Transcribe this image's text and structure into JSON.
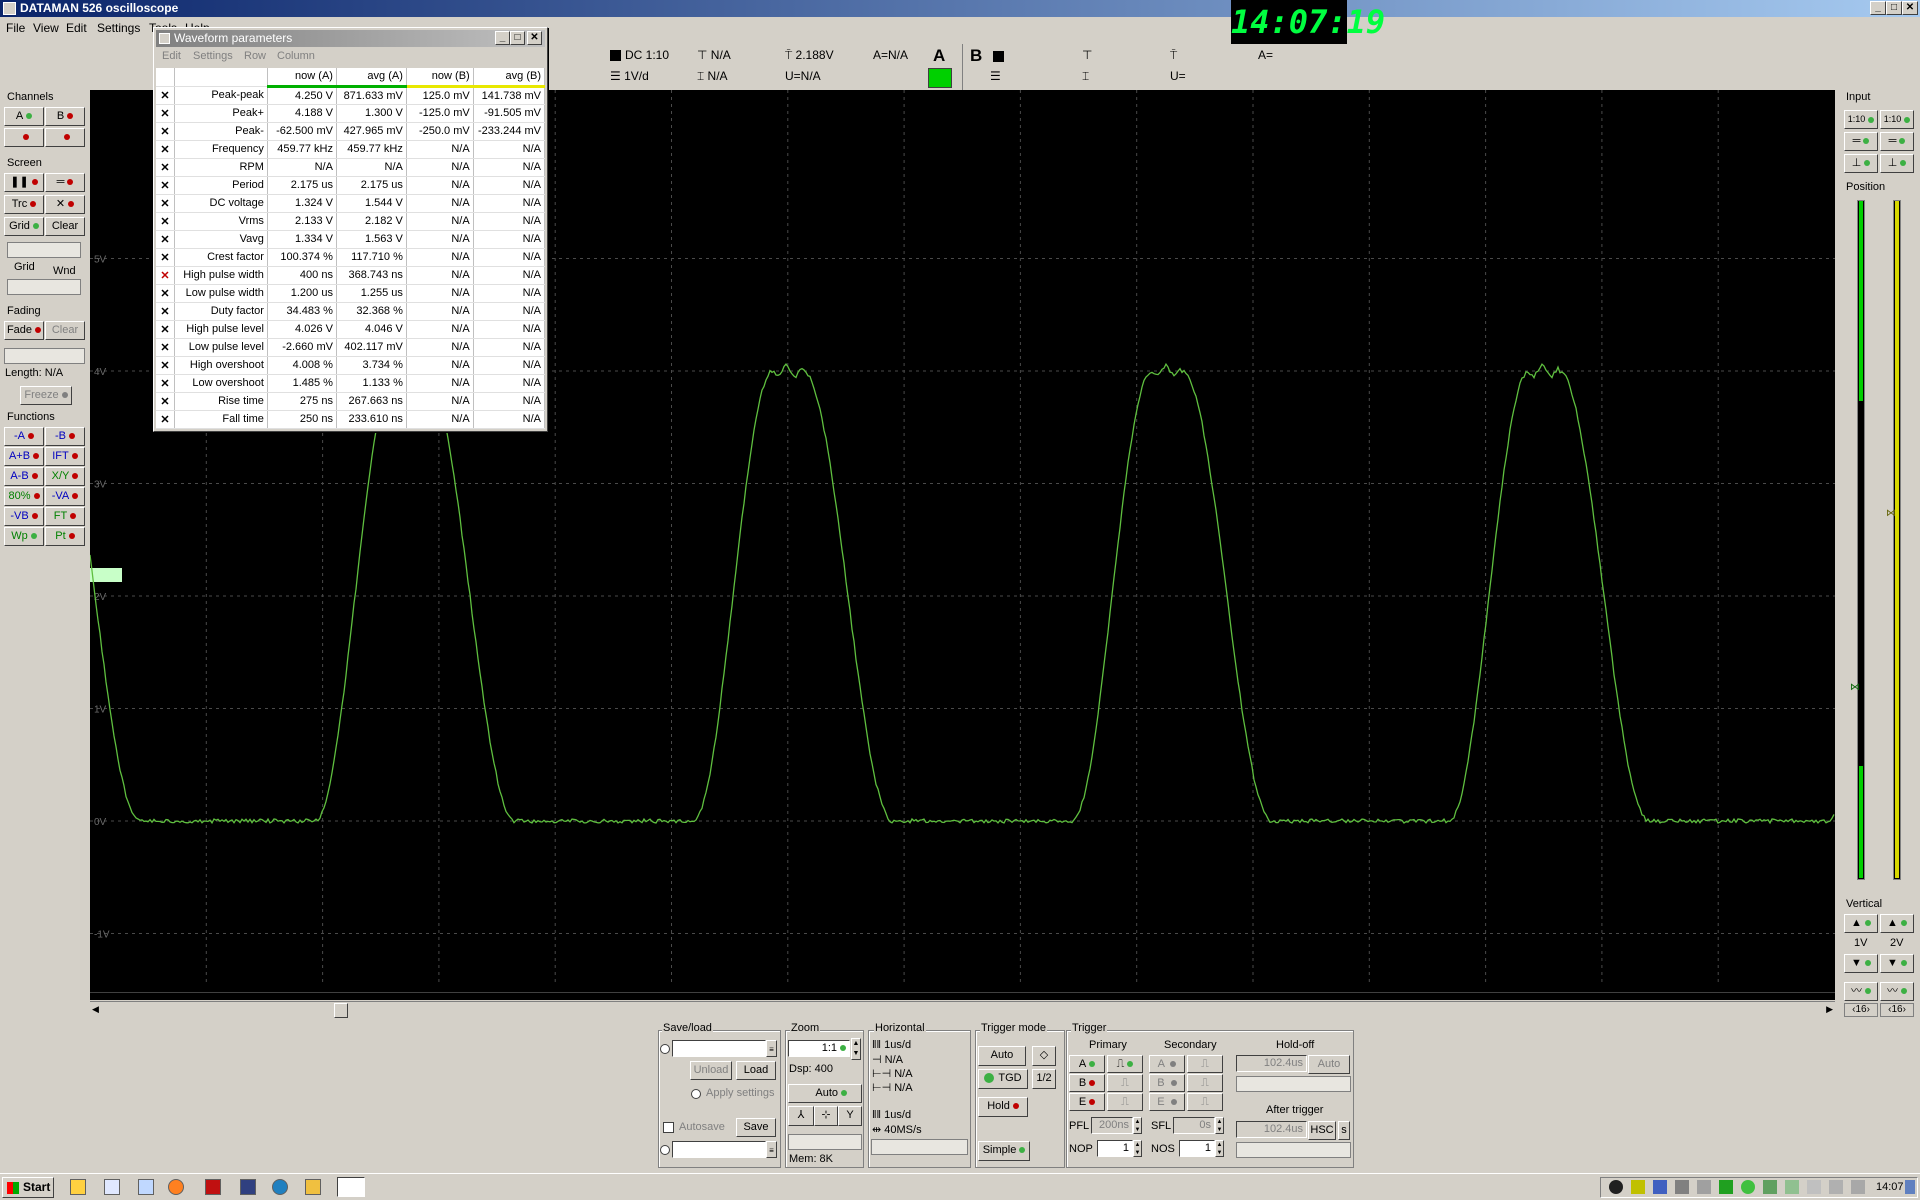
{
  "window": {
    "title": "DATAMAN 526 oscilloscope"
  },
  "menu": [
    "File",
    "View",
    "Edit",
    "Settings",
    "Tools",
    "Help"
  ],
  "clock": "14:07:19",
  "toolbar": {
    "a_coupling": "DC 1:10",
    "a_scale": "1V/d",
    "a_trig_level": "N/A",
    "a_time_cursor": "N/A",
    "a_volt": "2.188V",
    "a_u": "U=N/A",
    "a_eq": "A=N/A",
    "channel_a": "A",
    "channel_b": "B",
    "b_u": "U=",
    "b_eq": "A="
  },
  "left": {
    "channels_label": "Channels",
    "ch_a": "A",
    "ch_b": "B",
    "screen_label": "Screen",
    "trc": "Trc",
    "grid": "Grid",
    "clear": "Clear",
    "grid2": "Grid",
    "wnd": "Wnd",
    "fading_label": "Fading",
    "fade": "Fade",
    "fade_clear": "Clear",
    "length": "Length: N/A",
    "freeze": "Freeze",
    "functions_label": "Functions",
    "functions": [
      [
        "-A",
        "-B"
      ],
      [
        "A+B",
        "IFT"
      ],
      [
        "A-B",
        "X/Y"
      ],
      [
        "80%",
        "-VA"
      ],
      [
        "-VB",
        "FT"
      ],
      [
        "Wp",
        "Pt"
      ]
    ]
  },
  "params": {
    "title": "Waveform parameters",
    "menu": [
      "Edit",
      "Settings",
      "Row",
      "Column"
    ],
    "headers": [
      "now (A)",
      "avg (A)",
      "now (B)",
      "avg (B)"
    ],
    "rows": [
      {
        "name": "Peak-peak",
        "v": [
          "4.250 V",
          "871.633 mV",
          "125.0 mV",
          "141.738 mV"
        ]
      },
      {
        "name": "Peak+",
        "v": [
          "4.188 V",
          "1.300 V",
          "-125.0 mV",
          "-91.505 mV"
        ]
      },
      {
        "name": "Peak-",
        "v": [
          "-62.500 mV",
          "427.965 mV",
          "-250.0 mV",
          "-233.244 mV"
        ]
      },
      {
        "name": "Frequency",
        "v": [
          "459.77 kHz",
          "459.77 kHz",
          "N/A",
          "N/A"
        ]
      },
      {
        "name": "RPM",
        "v": [
          "N/A",
          "N/A",
          "N/A",
          "N/A"
        ]
      },
      {
        "name": "Period",
        "v": [
          "2.175 us",
          "2.175 us",
          "N/A",
          "N/A"
        ]
      },
      {
        "name": "DC voltage",
        "v": [
          "1.324 V",
          "1.544 V",
          "N/A",
          "N/A"
        ]
      },
      {
        "name": "Vrms",
        "v": [
          "2.133 V",
          "2.182 V",
          "N/A",
          "N/A"
        ]
      },
      {
        "name": "Vavg",
        "v": [
          "1.334 V",
          "1.563 V",
          "N/A",
          "N/A"
        ]
      },
      {
        "name": "Crest factor",
        "v": [
          "100.374 %",
          "117.710 %",
          "N/A",
          "N/A"
        ]
      },
      {
        "name": "High pulse width",
        "v": [
          "400 ns",
          "368.743 ns",
          "N/A",
          "N/A"
        ]
      },
      {
        "name": "Low pulse width",
        "v": [
          "1.200 us",
          "1.255 us",
          "N/A",
          "N/A"
        ]
      },
      {
        "name": "Duty factor",
        "v": [
          "34.483 %",
          "32.368 %",
          "N/A",
          "N/A"
        ]
      },
      {
        "name": "High pulse level",
        "v": [
          "4.026 V",
          "4.046 V",
          "N/A",
          "N/A"
        ]
      },
      {
        "name": "Low pulse level",
        "v": [
          "-2.660 mV",
          "402.117 mV",
          "N/A",
          "N/A"
        ]
      },
      {
        "name": "High overshoot",
        "v": [
          "4.008 %",
          "3.734 %",
          "N/A",
          "N/A"
        ]
      },
      {
        "name": "Low overshoot",
        "v": [
          "1.485 %",
          "1.133 %",
          "N/A",
          "N/A"
        ]
      },
      {
        "name": "Rise time",
        "v": [
          "275 ns",
          "267.663 ns",
          "N/A",
          "N/A"
        ]
      },
      {
        "name": "Fall time",
        "v": [
          "250 ns",
          "233.610 ns",
          "N/A",
          "N/A"
        ]
      }
    ]
  },
  "scope": {
    "volt_labels": [
      "5V",
      "4V",
      "3V",
      "2V",
      "1V",
      "0V",
      "-1V"
    ],
    "period_divs": 2.175,
    "high_level_v": 4.0,
    "low_level_v": 0.0,
    "trace_color": "#5fbf3f"
  },
  "right": {
    "input_label": "Input",
    "in_a": "1:10",
    "in_b": "1:10",
    "position_label": "Position",
    "vertical_label": "Vertical",
    "v_a": "1V",
    "v_b": "2V",
    "sp_a": "16",
    "sp_b": "16"
  },
  "bottom": {
    "saveload_label": "Save/load",
    "unload": "Unload",
    "load": "Load",
    "apply_settings": "Apply settings",
    "autosave": "Autosave",
    "save": "Save",
    "zoom_label": "Zoom",
    "zoom_value": "1:1",
    "dsp": "Dsp:  400",
    "auto": "Auto",
    "mem": "Mem: 8K",
    "horizontal_label": "Horizontal",
    "h_timebase": "1us/d",
    "h_na1": "N/A",
    "h_na2": "N/A",
    "h_na3": "N/A",
    "h_timebase2": "1us/d",
    "h_rate": "40MS/s",
    "trigmode_label": "Trigger mode",
    "tm_auto": "Auto",
    "tm_tgd": "TGD",
    "tm_half": "1/2",
    "tm_hold": "Hold",
    "tm_simple": "Simple",
    "trigger_label": "Trigger",
    "primary": "Primary",
    "secondary": "Secondary",
    "holdoff_label": "Hold-off",
    "holdoff_value": "102.4us",
    "holdoff_auto": "Auto",
    "after_trigger": "After trigger",
    "after_value": "102.4us",
    "hsc": "HSC",
    "s_btn": "s",
    "pa": "A",
    "pb": "B",
    "pe": "E",
    "pfl": "PFL",
    "pfl_value": "200ns",
    "sfl": "SFL",
    "sfl_value": "0s",
    "nop": "NOP",
    "nop_value": "1",
    "nos": "NOS",
    "nos_value": "1"
  },
  "taskbar": {
    "start": "Start",
    "time": "14:07"
  }
}
